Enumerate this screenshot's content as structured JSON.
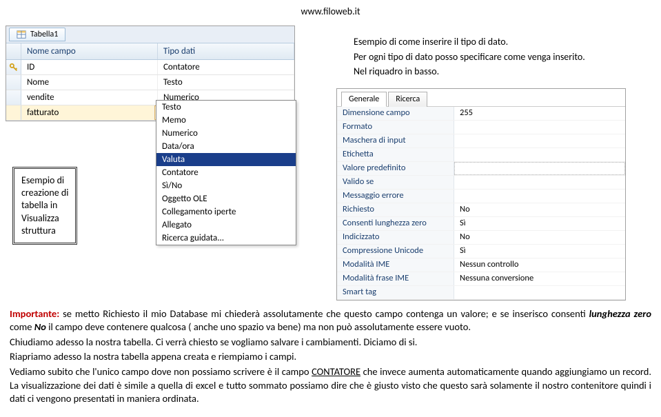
{
  "header": {
    "url": "www.filoweb.it"
  },
  "intro": {
    "line1": "Esempio di come inserire il tipo di dato.",
    "line2": "Per ogni tipo di dato posso specificare come venga inserito.",
    "line3": "Nel riquadro in basso."
  },
  "designer": {
    "tab_label": "Tabella1",
    "col_name": "Nome campo",
    "col_type": "Tipo dati",
    "rows": [
      {
        "name": "ID",
        "type": "Contatore",
        "pk": true
      },
      {
        "name": "Nome",
        "type": "Testo"
      },
      {
        "name": "vendite",
        "type": "Numerico"
      },
      {
        "name": "fatturato",
        "type": "Valuta",
        "combo": true,
        "highlight": true
      }
    ]
  },
  "dropdown": {
    "items": [
      "Testo",
      "Memo",
      "Numerico",
      "Data/ora",
      "Valuta",
      "Contatore",
      "Sì/No",
      "Oggetto OLE",
      "Collegamento iperte",
      "Allegato",
      "Ricerca guidata..."
    ],
    "selected": "Valuta"
  },
  "callout": {
    "l1": "Esempio di",
    "l2": "creazione di",
    "l3": "tabella in",
    "l4": "Visualizza",
    "l5": "struttura"
  },
  "props": {
    "tab1": "Generale",
    "tab2": "Ricerca",
    "rows": [
      {
        "label": "Dimensione campo",
        "value": "255"
      },
      {
        "label": "Formato",
        "value": ""
      },
      {
        "label": "Maschera di input",
        "value": ""
      },
      {
        "label": "Etichetta",
        "value": ""
      },
      {
        "label": "Valore predefinito",
        "value": "",
        "boxed": true
      },
      {
        "label": "Valido se",
        "value": ""
      },
      {
        "label": "Messaggio errore",
        "value": ""
      },
      {
        "label": "Richiesto",
        "value": "No"
      },
      {
        "label": "Consenti lunghezza zero",
        "value": "Sì"
      },
      {
        "label": "Indicizzato",
        "value": "No"
      },
      {
        "label": "Compressione Unicode",
        "value": "Sì"
      },
      {
        "label": "Modalità IME",
        "value": "Nessun controllo"
      },
      {
        "label": "Modalità frase IME",
        "value": "Nessuna conversione"
      },
      {
        "label": "Smart tag",
        "value": ""
      }
    ]
  },
  "body": {
    "p1a": "Importante:",
    "p1b": " se metto Richiesto il mio Database mi chiederà assolutamente che questo campo contenga un valore; e se inserisco consenti ",
    "p1c": "lunghezza zero",
    "p1d": " come ",
    "p1e": "No",
    "p1f": " il campo deve contenere qualcosa ( anche uno spazio va bene) ma non può assolutamente essere vuoto.",
    "p2": "Chiudiamo adesso la nostra tabella. Ci verrà chiesto se vogliamo salvare i cambiamenti. Diciamo di si.",
    "p3": "Riapriamo adesso la nostra tabella appena creata e riempiamo i campi.",
    "p4a": "Vediamo subito che l'unico campo dove non possiamo scrivere è il campo ",
    "p4b": "CONTATORE",
    "p4c": " che invece aumenta automaticamente quando aggiungiamo un record. La visualizzazione dei dati è simile a quella di excel e tutto sommato possiamo dire che è giusto visto che questo sarà solamente il nostro contenitore quindi i dati ci vengono presentati in maniera ordinata."
  }
}
